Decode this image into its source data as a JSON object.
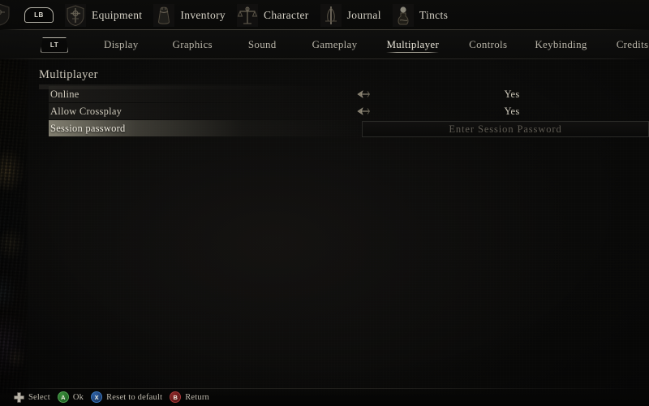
{
  "topnav": {
    "bumper_label": "LB",
    "items": [
      {
        "label": "Equipment",
        "icon": "crest-shield-icon"
      },
      {
        "label": "Inventory",
        "icon": "pouch-icon"
      },
      {
        "label": "Character",
        "icon": "scales-icon"
      },
      {
        "label": "Journal",
        "icon": "quill-icon"
      },
      {
        "label": "Tincts",
        "icon": "flask-icon"
      }
    ]
  },
  "tabbar": {
    "trigger_label": "LT",
    "active": "Multiplayer",
    "tabs": [
      {
        "label": "Display"
      },
      {
        "label": "Graphics"
      },
      {
        "label": "Sound"
      },
      {
        "label": "Gameplay"
      },
      {
        "label": "Multiplayer"
      },
      {
        "label": "Controls"
      },
      {
        "label": "Keybinding"
      },
      {
        "label": "Credits"
      }
    ]
  },
  "content": {
    "section_title": "Multiplayer",
    "settings": [
      {
        "label": "Online",
        "value": "Yes",
        "type": "toggle",
        "selected": false
      },
      {
        "label": "Allow Crossplay",
        "value": "Yes",
        "type": "toggle",
        "selected": false
      },
      {
        "label": "Session password",
        "value": "",
        "placeholder": "Enter Session Password",
        "type": "text",
        "selected": true
      }
    ]
  },
  "bottombar": {
    "prompts": [
      {
        "glyph": "dpad",
        "button": "",
        "label": "Select"
      },
      {
        "glyph": "round",
        "button": "A",
        "label": "Ok",
        "color": "#3c8f3c"
      },
      {
        "glyph": "round",
        "button": "X",
        "label": "Reset to default",
        "color": "#2f63a8"
      },
      {
        "glyph": "round",
        "button": "B",
        "label": "Return",
        "color": "#8e2a2a"
      }
    ]
  },
  "colors": {
    "background": "#090908",
    "text": "#cdc8ba",
    "highlight": "#b0ac98",
    "accent_a": "#3c8f3c",
    "accent_x": "#2f63a8",
    "accent_b": "#8e2a2a"
  }
}
